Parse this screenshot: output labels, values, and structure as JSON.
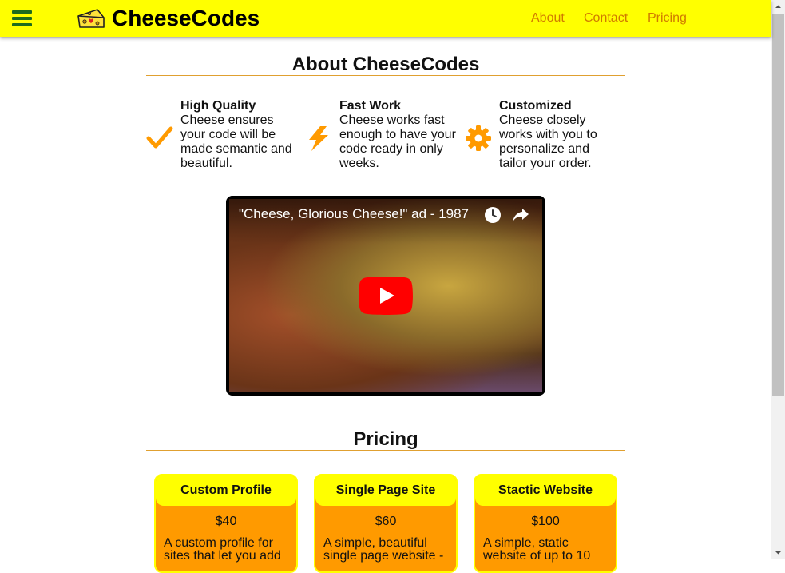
{
  "header": {
    "brand": "CheeseCodes",
    "nav": [
      "About",
      "Contact",
      "Pricing"
    ]
  },
  "about": {
    "title": "About CheeseCodes",
    "features": [
      {
        "title": "High Quality",
        "text": "Cheese ensures your code will be made semantic and beautiful.",
        "icon": "checkmark-icon"
      },
      {
        "title": "Fast Work",
        "text": "Cheese works fast enough to have your code ready in only weeks.",
        "icon": "lightning-icon"
      },
      {
        "title": "Customized",
        "text": "Cheese closely works with you to personalize and tailor your order.",
        "icon": "gear-icon"
      }
    ]
  },
  "video": {
    "title": "\"Cheese, Glorious Cheese!\" ad - 1987"
  },
  "pricing": {
    "title": "Pricing",
    "cards": [
      {
        "name": "Custom Profile",
        "price": "$40",
        "desc": "A custom profile for sites that let you add"
      },
      {
        "name": "Single Page Site",
        "price": "$60",
        "desc": "A simple, beautiful single page website -"
      },
      {
        "name": "Stactic Website",
        "price": "$100",
        "desc": "A simple, static website of up to 10"
      }
    ]
  },
  "colors": {
    "header_bg": "#ffff00",
    "accent": "#ff9a00",
    "nav_link": "#d07a00",
    "hamburger": "#1e6b1e"
  }
}
